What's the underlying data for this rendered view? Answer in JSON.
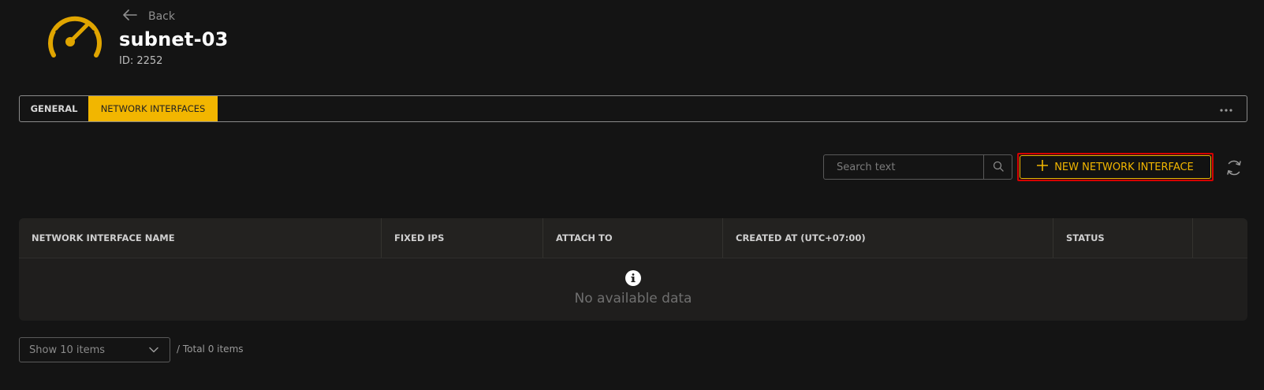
{
  "header": {
    "back_label": "Back",
    "title": "subnet-03",
    "id_text": "ID: 2252"
  },
  "tabs": [
    {
      "label": "GENERAL",
      "active": false
    },
    {
      "label": "NETWORK INTERFACES",
      "active": true
    }
  ],
  "tabs_more_icon": "ellipsis-icon",
  "toolbar": {
    "search_placeholder": "Search text",
    "search_value": "",
    "new_button_label": "NEW NETWORK INTERFACE"
  },
  "table": {
    "columns": [
      "NETWORK INTERFACE NAME",
      "FIXED IPS",
      "ATTACH TO",
      "CREATED AT (UTC+07:00)",
      "STATUS",
      ""
    ],
    "rows": [],
    "empty_text": "No available data"
  },
  "pagination": {
    "page_size_label": "Show 10 items",
    "total_text": "/ Total 0 items"
  },
  "colors": {
    "accent": "#f2b600",
    "background": "#141414",
    "highlight_border": "#d60000"
  }
}
